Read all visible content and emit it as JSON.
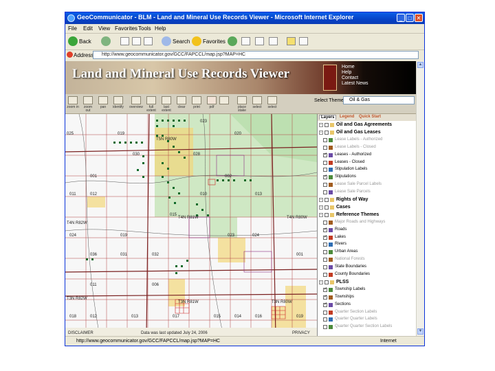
{
  "window": {
    "title": "GeoCommunicator - BLM - Land and Mineral Use Records Viewer - Microsoft Internet Explorer"
  },
  "menu": [
    "File",
    "Edit",
    "View",
    "Favorites",
    "Tools",
    "Help"
  ],
  "toolbar": {
    "back": "Back",
    "search": "Search",
    "favorites": "Favorites"
  },
  "address": {
    "label": "Address",
    "url": "http://www.geocommunicator.gov/GCC/FAPCCL/map.jsp?MAP=HC"
  },
  "banner": {
    "title": "Land and Mineral Use Records Viewer",
    "links": [
      "Home",
      "Help",
      "Contact",
      "Latest News"
    ]
  },
  "tools": {
    "labels": [
      "zoom in",
      "zoom out",
      "pan",
      "identify",
      "overview",
      "full extent",
      "last extent",
      "clear",
      "print",
      "pdf",
      "",
      "place stake",
      "select",
      "select"
    ],
    "select_label": "Select Theme:",
    "select_value": "Oil & Gas"
  },
  "panel": {
    "tabs": [
      "Layers",
      "Legend",
      "Quick Start"
    ],
    "layers": [
      {
        "kind": "header",
        "text": "Oil and Gas Agreements",
        "checked": false,
        "indent": 0
      },
      {
        "kind": "header",
        "text": "Oil and Gas Leases",
        "checked": false,
        "indent": 0
      },
      {
        "kind": "item",
        "text": "Lease Labels - Authorized",
        "checked": false,
        "indent": 1,
        "dim": true
      },
      {
        "kind": "item",
        "text": "Lease Labels - Closed",
        "checked": false,
        "indent": 1,
        "dim": true
      },
      {
        "kind": "item",
        "text": "Leases - Authorized",
        "checked": true,
        "indent": 1,
        "dim": false
      },
      {
        "kind": "item",
        "text": "Leases - Closed",
        "checked": false,
        "indent": 1,
        "dim": false
      },
      {
        "kind": "item",
        "text": "Stipulation Labels",
        "checked": false,
        "indent": 1,
        "dim": false
      },
      {
        "kind": "item",
        "text": "Stipulations",
        "checked": true,
        "indent": 1,
        "dim": false
      },
      {
        "kind": "item",
        "text": "Lease Sale Parcel Labels",
        "checked": false,
        "indent": 1,
        "dim": true
      },
      {
        "kind": "item",
        "text": "Lease Sale Parcels",
        "checked": false,
        "indent": 1,
        "dim": true
      },
      {
        "kind": "header",
        "text": "Rights of Way",
        "checked": false,
        "indent": 0
      },
      {
        "kind": "header",
        "text": "Cases",
        "checked": false,
        "indent": 0
      },
      {
        "kind": "header",
        "text": "Reference Themes",
        "checked": false,
        "indent": 0
      },
      {
        "kind": "item",
        "text": "Major Roads and Highways",
        "checked": false,
        "indent": 1,
        "dim": true
      },
      {
        "kind": "item",
        "text": "Roads",
        "checked": true,
        "indent": 1,
        "dim": false
      },
      {
        "kind": "item",
        "text": "Lakes",
        "checked": true,
        "indent": 1,
        "dim": false
      },
      {
        "kind": "item",
        "text": "Rivers",
        "checked": false,
        "indent": 1,
        "dim": false
      },
      {
        "kind": "item",
        "text": "Urban Areas",
        "checked": false,
        "indent": 1,
        "dim": false
      },
      {
        "kind": "item",
        "text": "National Forests",
        "checked": false,
        "indent": 1,
        "dim": true
      },
      {
        "kind": "item",
        "text": "State Boundaries",
        "checked": false,
        "indent": 1,
        "dim": false
      },
      {
        "kind": "item",
        "text": "County Boundaries",
        "checked": false,
        "indent": 1,
        "dim": false
      },
      {
        "kind": "header",
        "text": "PLSS",
        "checked": false,
        "indent": 0
      },
      {
        "kind": "item",
        "text": "Township Labels",
        "checked": true,
        "indent": 1,
        "dim": false
      },
      {
        "kind": "item",
        "text": "Townships",
        "checked": true,
        "indent": 1,
        "dim": false
      },
      {
        "kind": "item",
        "text": "Sections",
        "checked": true,
        "indent": 1,
        "dim": false
      },
      {
        "kind": "item",
        "text": "Quarter Section Labels",
        "checked": false,
        "indent": 1,
        "dim": true
      },
      {
        "kind": "item",
        "text": "Quarter Quarter Labels",
        "checked": false,
        "indent": 1,
        "dim": true
      },
      {
        "kind": "item",
        "text": "Quarter Quarter Section Labels",
        "checked": false,
        "indent": 1,
        "dim": true
      }
    ]
  },
  "map": {
    "township_labels": [
      "T5N R80W",
      "T4N R82W",
      "T4N R81W",
      "T4N R80W",
      "T3N R82W",
      "T3N R81W",
      "T3N R80W"
    ],
    "section_labels": [
      "023",
      "019",
      "020",
      "025",
      "030",
      "028",
      "002",
      "001",
      "011",
      "012",
      "010",
      "013",
      "015",
      "024",
      "019",
      "023",
      "024",
      "036",
      "031",
      "032",
      "001",
      "006",
      "011",
      "012",
      "013",
      "014",
      "015",
      "017",
      "018",
      "016",
      "019"
    ],
    "footer_left": "DISCLAIMER",
    "footer_mid": "Data was last updated July 24, 2006",
    "footer_right": "PRIVACY"
  },
  "status": {
    "url": "http://www.geocommunicator.gov/GCC/FAPCCL/map.jsp?MAP=HC",
    "zone": "Internet"
  }
}
